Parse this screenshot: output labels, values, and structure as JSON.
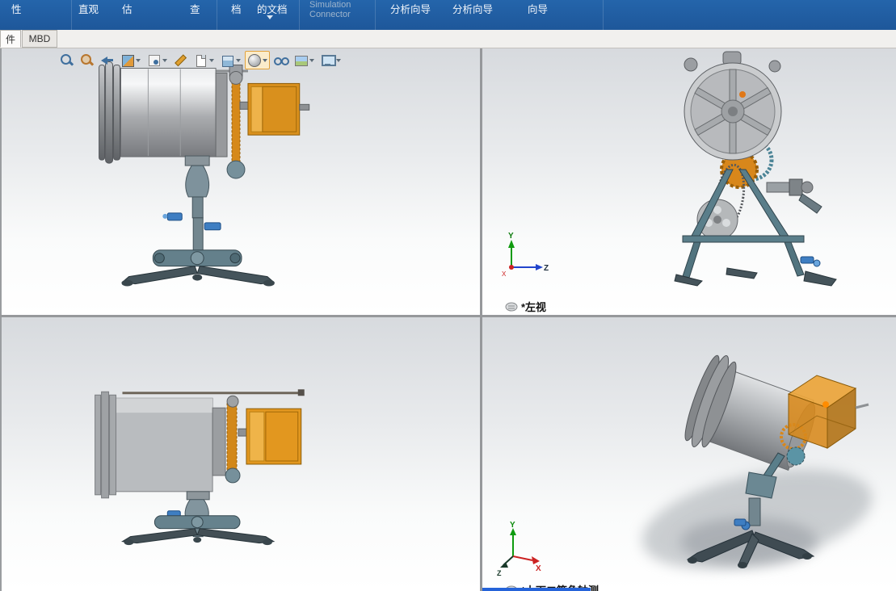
{
  "ribbon": {
    "items": [
      {
        "label": "性"
      },
      {
        "label": "直观"
      },
      {
        "label": "估"
      },
      {
        "label": "查"
      },
      {
        "label": "档"
      },
      {
        "label": "的文档",
        "dropdown": true
      },
      {
        "label": "Simulation Connector",
        "disabled": true
      },
      {
        "label": "分析向导"
      },
      {
        "label": "分析向导"
      },
      {
        "label": "向导"
      }
    ]
  },
  "tabs": {
    "items": [
      {
        "label": "件",
        "active": true
      },
      {
        "label": "MBD",
        "active": false
      }
    ]
  },
  "headsup": {
    "icons": [
      {
        "name": "zoom-fit"
      },
      {
        "name": "zoom-area"
      },
      {
        "name": "previous-view"
      },
      {
        "name": "section-view",
        "dropdown": true
      },
      {
        "name": "annotation-visibility",
        "dropdown": true
      },
      {
        "name": "edit-appearance-pencil"
      },
      {
        "name": "copy-settings",
        "dropdown": true
      },
      {
        "name": "view-orientation",
        "dropdown": true
      },
      {
        "name": "display-style",
        "dropdown": true,
        "selected": true
      },
      {
        "name": "hide-show-items"
      },
      {
        "name": "apply-scene",
        "dropdown": true
      },
      {
        "name": "view-settings",
        "dropdown": true
      }
    ]
  },
  "viewports": {
    "top_right": {
      "label": "*左视",
      "triad": {
        "up": "Y",
        "right": "Z",
        "out": "X"
      }
    },
    "bottom_right": {
      "label": "*上下二等角轴测",
      "triad": {
        "up": "Y",
        "right": "X",
        "out": "Z"
      }
    }
  },
  "colors": {
    "ribbon_blue": "#2160a5",
    "accent_orange": "#d8891a",
    "frame_teal": "#5a7e8a",
    "selection_blue": "#2563d9"
  }
}
